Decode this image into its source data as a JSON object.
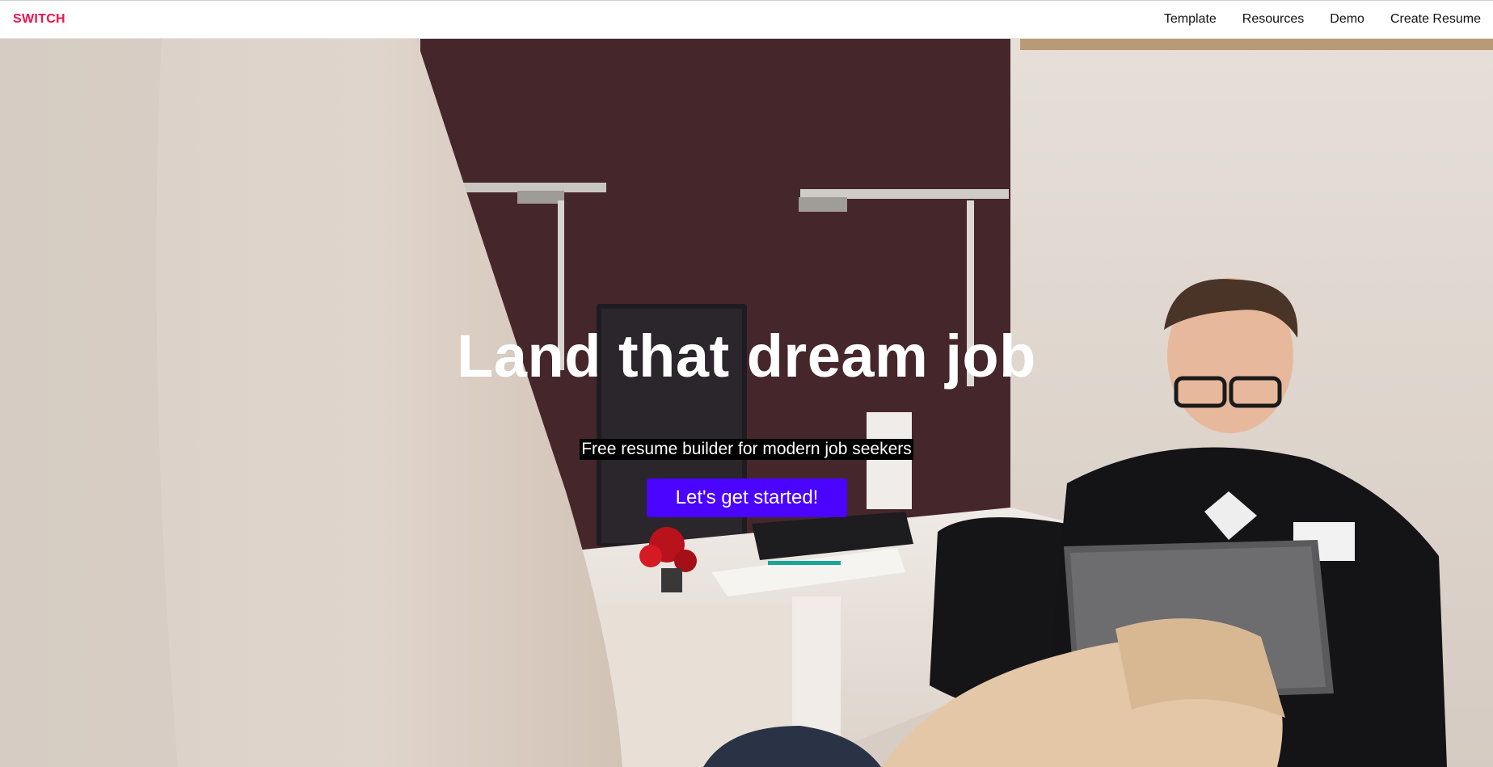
{
  "header": {
    "brand": "SWITCH",
    "nav": [
      {
        "label": "Template"
      },
      {
        "label": "Resources"
      },
      {
        "label": "Demo"
      },
      {
        "label": "Create Resume"
      }
    ]
  },
  "hero": {
    "title": "Land that dream job",
    "subtitle": "Free resume builder for modern job seekers",
    "cta_label": "Let's get started!"
  },
  "colors": {
    "brand": "#f0104a",
    "cta": "#4a04ff",
    "subtitle_bg": "#000000"
  }
}
